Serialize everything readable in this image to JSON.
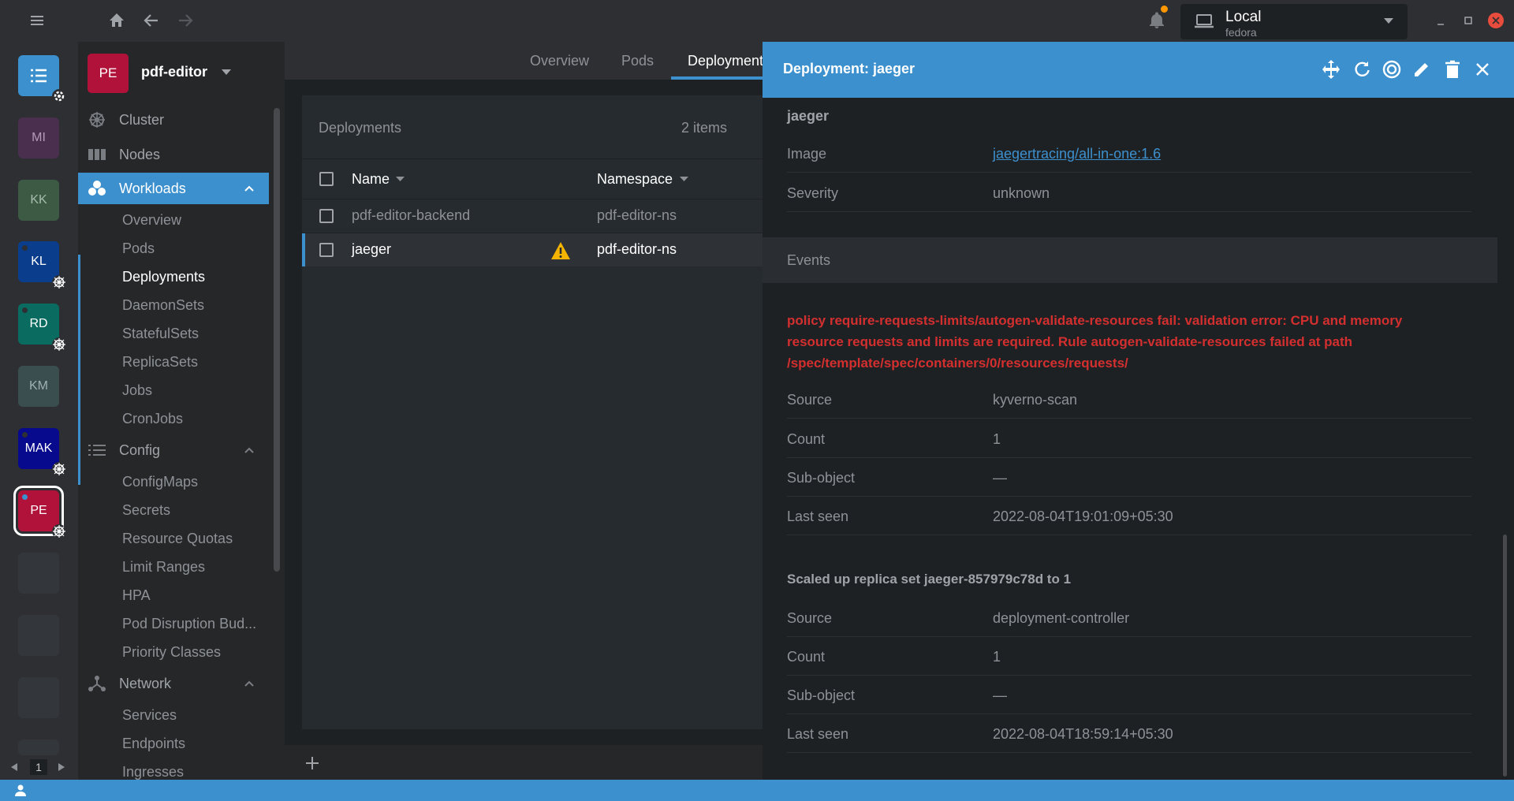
{
  "topbar": {
    "context": {
      "name": "Local",
      "sub": "fedora"
    }
  },
  "hotbar": {
    "items": [
      {
        "label": "",
        "color": "#3d90ce"
      },
      {
        "label": "MI",
        "color": "#4a2f4f"
      },
      {
        "label": "KK",
        "color": "#3d5a45"
      },
      {
        "label": "KL",
        "color": "#0a3e8c"
      },
      {
        "label": "RD",
        "color": "#0a6b60"
      },
      {
        "label": "KM",
        "color": "#3a4d4f"
      },
      {
        "label": "MAK",
        "color": "#070a8c"
      },
      {
        "label": "PE",
        "color": "#b0123a"
      }
    ],
    "page": "1"
  },
  "sidebar": {
    "cluster_badge": "PE",
    "cluster_name": "pdf-editor",
    "cluster": "Cluster",
    "nodes": "Nodes",
    "workloads": {
      "label": "Workloads",
      "items": [
        "Overview",
        "Pods",
        "Deployments",
        "DaemonSets",
        "StatefulSets",
        "ReplicaSets",
        "Jobs",
        "CronJobs"
      ]
    },
    "config": {
      "label": "Config",
      "items": [
        "ConfigMaps",
        "Secrets",
        "Resource Quotas",
        "Limit Ranges",
        "HPA",
        "Pod Disruption Bud...",
        "Priority Classes"
      ]
    },
    "network": {
      "label": "Network",
      "items": [
        "Services",
        "Endpoints",
        "Ingresses"
      ]
    }
  },
  "tabs": [
    "Overview",
    "Pods",
    "Deployment"
  ],
  "list": {
    "title": "Deployments",
    "count": "2 items",
    "columns": {
      "name": "Name",
      "namespace": "Namespace"
    },
    "rows": [
      {
        "name": "pdf-editor-backend",
        "namespace": "pdf-editor-ns"
      },
      {
        "name": "jaeger",
        "namespace": "pdf-editor-ns"
      }
    ]
  },
  "drawer": {
    "title": "Deployment: jaeger",
    "container_name": "jaeger",
    "image_label": "Image",
    "image_value": "jaegertracing/all-in-one:1.6",
    "severity_label": "Severity",
    "severity_value": "unknown",
    "events_label": "Events",
    "events": [
      {
        "message": "policy require-requests-limits/autogen-validate-resources fail: validation error: CPU and memory resource requests and limits are required. Rule autogen-validate-resources failed at path /spec/template/spec/containers/0/resources/requests/",
        "source_label": "Source",
        "source": "kyverno-scan",
        "count_label": "Count",
        "count": "1",
        "subobject_label": "Sub-object",
        "subobject": "—",
        "lastseen_label": "Last seen",
        "lastseen": "2022-08-04T19:01:09+05:30"
      },
      {
        "message": "Scaled up replica set jaeger-857979c78d to 1",
        "source_label": "Source",
        "source": "deployment-controller",
        "count_label": "Count",
        "count": "1",
        "subobject_label": "Sub-object",
        "subobject": "—",
        "lastseen_label": "Last seen",
        "lastseen": "2022-08-04T18:59:14+05:30"
      }
    ]
  },
  "colors": {
    "accent": "#3d90ce",
    "error": "#d32f2f",
    "warning": "#f5b400",
    "notification": "#ff9800"
  }
}
